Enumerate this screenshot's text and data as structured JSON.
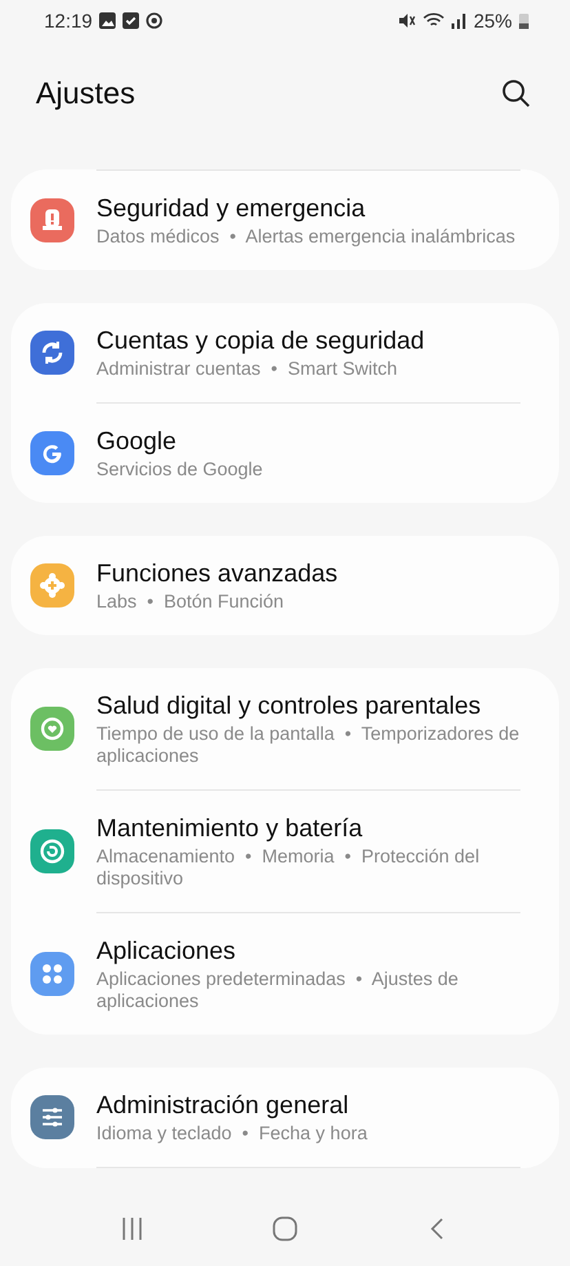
{
  "status_bar": {
    "time": "12:19",
    "battery": "25%"
  },
  "header": {
    "title": "Ajustes"
  },
  "groups": [
    {
      "items": [
        {
          "color": "#ea6b5e",
          "title": "Seguridad y emergencia",
          "subtitle": "Datos médicos  •  Alertas emergencia inalámbricas"
        }
      ]
    },
    {
      "items": [
        {
          "color": "#3f6fd8",
          "title": "Cuentas y copia de seguridad",
          "subtitle": "Administrar cuentas  •  Smart Switch"
        },
        {
          "color": "#4a8af4",
          "title": "Google",
          "subtitle": "Servicios de Google"
        }
      ]
    },
    {
      "items": [
        {
          "color": "#f5b342",
          "title": "Funciones avanzadas",
          "subtitle": "Labs  •  Botón Función"
        }
      ]
    },
    {
      "items": [
        {
          "color": "#6cbf63",
          "title": "Salud digital y controles parentales",
          "subtitle": "Tiempo de uso de la pantalla  •  Temporizadores de aplicaciones"
        },
        {
          "color": "#1fb08e",
          "title": "Mantenimiento y batería",
          "subtitle": "Almacenamiento  •  Memoria  •  Protección del dispositivo"
        },
        {
          "color": "#5f9cf0",
          "title": "Aplicaciones",
          "subtitle": "Aplicaciones predeterminadas  •  Ajustes de aplicaciones"
        }
      ]
    },
    {
      "items": [
        {
          "color": "#5b7fa0",
          "title": "Administración general",
          "subtitle": "Idioma y teclado  •  Fecha y hora"
        }
      ]
    }
  ]
}
